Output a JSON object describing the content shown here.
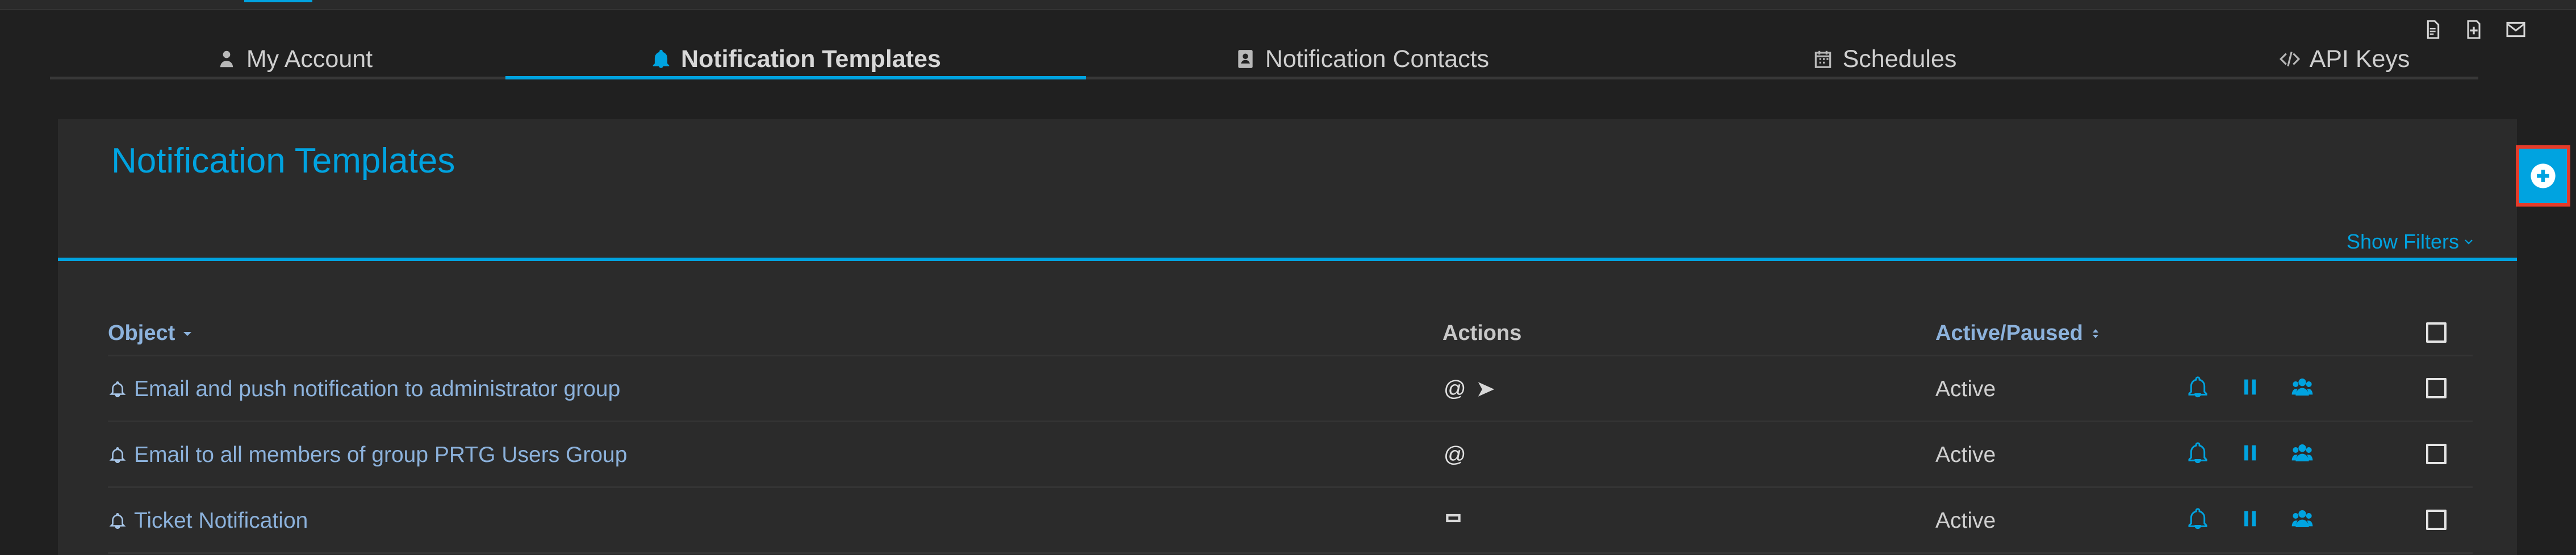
{
  "colors": {
    "accent": "#00a3e0",
    "highlight_border": "#e53b29",
    "link_text": "#8cb2dc"
  },
  "utility_icons": [
    "clipboard-icon",
    "file-plus-icon",
    "mail-icon"
  ],
  "tabs": [
    {
      "label": "My Account",
      "icon": "user-icon"
    },
    {
      "label": "Notification Templates",
      "icon": "bell-icon",
      "active": true
    },
    {
      "label": "Notification Contacts",
      "icon": "contacts-icon"
    },
    {
      "label": "Schedules",
      "icon": "calendar-icon"
    },
    {
      "label": "API Keys",
      "icon": "code-icon"
    }
  ],
  "panel": {
    "title": "Notification Templates",
    "show_filters": "Show Filters"
  },
  "table": {
    "headers": {
      "object": "Object",
      "actions": "Actions",
      "status": "Active/Paused"
    },
    "rows": [
      {
        "name": "Email and push notification to administrator group",
        "actions": [
          "at-icon",
          "send-icon"
        ],
        "status": "Active"
      },
      {
        "name": "Email to all members of group PRTG Users Group",
        "actions": [
          "at-icon"
        ],
        "status": "Active"
      },
      {
        "name": "Ticket Notification",
        "actions": [
          "ticket-icon"
        ],
        "status": "Active"
      }
    ],
    "row_icons": [
      "bell-icon",
      "pause-icon",
      "group-icon"
    ]
  },
  "add_button": {
    "icon": "plus-circle-icon"
  }
}
